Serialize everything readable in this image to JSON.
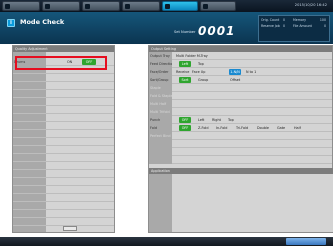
{
  "header": {
    "title": "Mode Check",
    "set_label": "Set Number",
    "set_value": "0001",
    "date": "2015/10/20 16:42",
    "info": [
      {
        "label": "Orig. Count",
        "value": "0",
        "label2": "Memory",
        "value2": "100"
      },
      {
        "label": "Reserve Job",
        "value": "0",
        "label2": "File Amount",
        "value2": "0"
      }
    ]
  },
  "top_tabs": [
    {
      "label": ""
    },
    {
      "label": ""
    },
    {
      "label": ""
    },
    {
      "label": ""
    },
    {
      "label": ""
    },
    {
      "label": ""
    }
  ],
  "left_panel": {
    "title": "Quality Adjustment",
    "rows": [
      {
        "label": "Drums",
        "on": "ON",
        "off": "OFF",
        "selected": "off"
      }
    ]
  },
  "right_panel": {
    "title": "Output Setting",
    "rows": [
      {
        "label": "Output Tray",
        "values": [
          "Multi Folder M-Tray"
        ]
      },
      {
        "label": "Feed Direction",
        "values": [
          "Left",
          "Top"
        ],
        "selected": 0
      },
      {
        "label": "Face/Order",
        "values": [
          "Receive",
          "Face Up",
          "1-N/N",
          "N to 1"
        ],
        "selected": 2
      },
      {
        "label": "Sort/Group",
        "values": [
          "Sort",
          "Group",
          "Offset"
        ],
        "selected": 0
      },
      {
        "label": "Staple",
        "values": [],
        "muted": true
      },
      {
        "label": "Fold & Staple",
        "values": [],
        "muted": true
      },
      {
        "label": "Multi Half",
        "values": [],
        "muted": true
      },
      {
        "label": "Multi Trifold",
        "values": [],
        "muted": true
      },
      {
        "label": "Punch",
        "values": [
          "OFF",
          "Left",
          "Right",
          "Top"
        ],
        "selected": 0
      },
      {
        "label": "Fold",
        "values": [
          "OFF",
          "Z-Fold",
          "In-Fold",
          "Tri-Fold",
          "Double",
          "Gate",
          "Half"
        ],
        "selected": 0
      },
      {
        "label": "Perfect Bind",
        "values": [],
        "muted": true
      }
    ],
    "application_title": "Application"
  },
  "colors": {
    "header_bg": "#15567a",
    "tab_active": "#2fc0ea",
    "selected_green": "#2fa52f",
    "highlight_red": "#e60d1f",
    "selected_blue": "#1a8ad0"
  }
}
